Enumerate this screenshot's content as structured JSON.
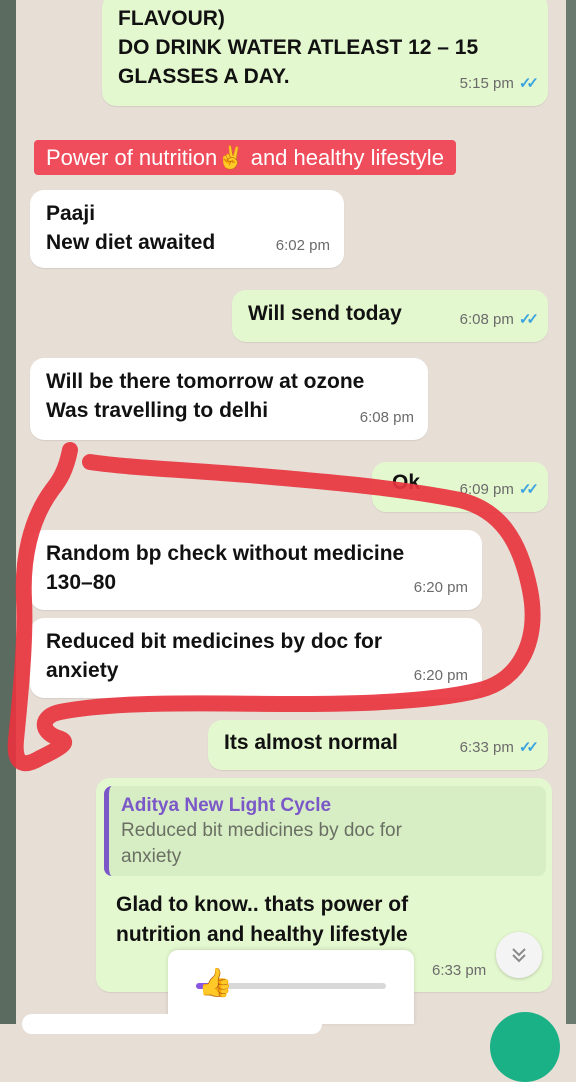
{
  "messages": {
    "m1": {
      "lines": [
        "FLAVOUR)",
        "DO DRINK WATER ATLEAST 12 – 15",
        "GLASSES A DAY."
      ],
      "time": "5:15 pm"
    },
    "label": "Power of nutrition✌️ and healthy lifestyle",
    "m2": {
      "lines": [
        "Paaji",
        "New diet awaited"
      ],
      "time": "6:02 pm"
    },
    "m3": {
      "text": "Will send today",
      "time": "6:08 pm"
    },
    "m4": {
      "lines": [
        "Will be there tomorrow at ozone",
        "Was travelling to delhi"
      ],
      "time": "6:08 pm"
    },
    "m5": {
      "text": "Ok",
      "time": "6:09 pm"
    },
    "m6": {
      "lines": [
        "Random bp check without medicine",
        "130–80"
      ],
      "time": "6:20 pm"
    },
    "m7": {
      "lines": [
        "Reduced bit medicines by doc for",
        "anxiety"
      ],
      "time": "6:20 pm"
    },
    "m8": {
      "text": "Its almost normal",
      "time": "6:33 pm"
    },
    "m9": {
      "reply_name": "Aditya New Light Cycle",
      "reply_lines": [
        "Reduced bit medicines by doc for",
        "anxiety"
      ],
      "lines": [
        "Glad to know.. thats power of",
        "nutrition and healthy lifestyle"
      ],
      "time": "6:33 pm"
    }
  },
  "icons": {
    "ticks": "✓✓",
    "scroll": "chevrons-down-icon",
    "reaction": "👍"
  },
  "player": {
    "progress_percent": 10
  },
  "colors": {
    "label": "#ef4c5c",
    "outgoing": "#e4f8cf",
    "incoming": "#ffffff",
    "ticks": "#3ba3e0",
    "reply_accent": "#7b58c8",
    "scribble": "#e8343f"
  }
}
